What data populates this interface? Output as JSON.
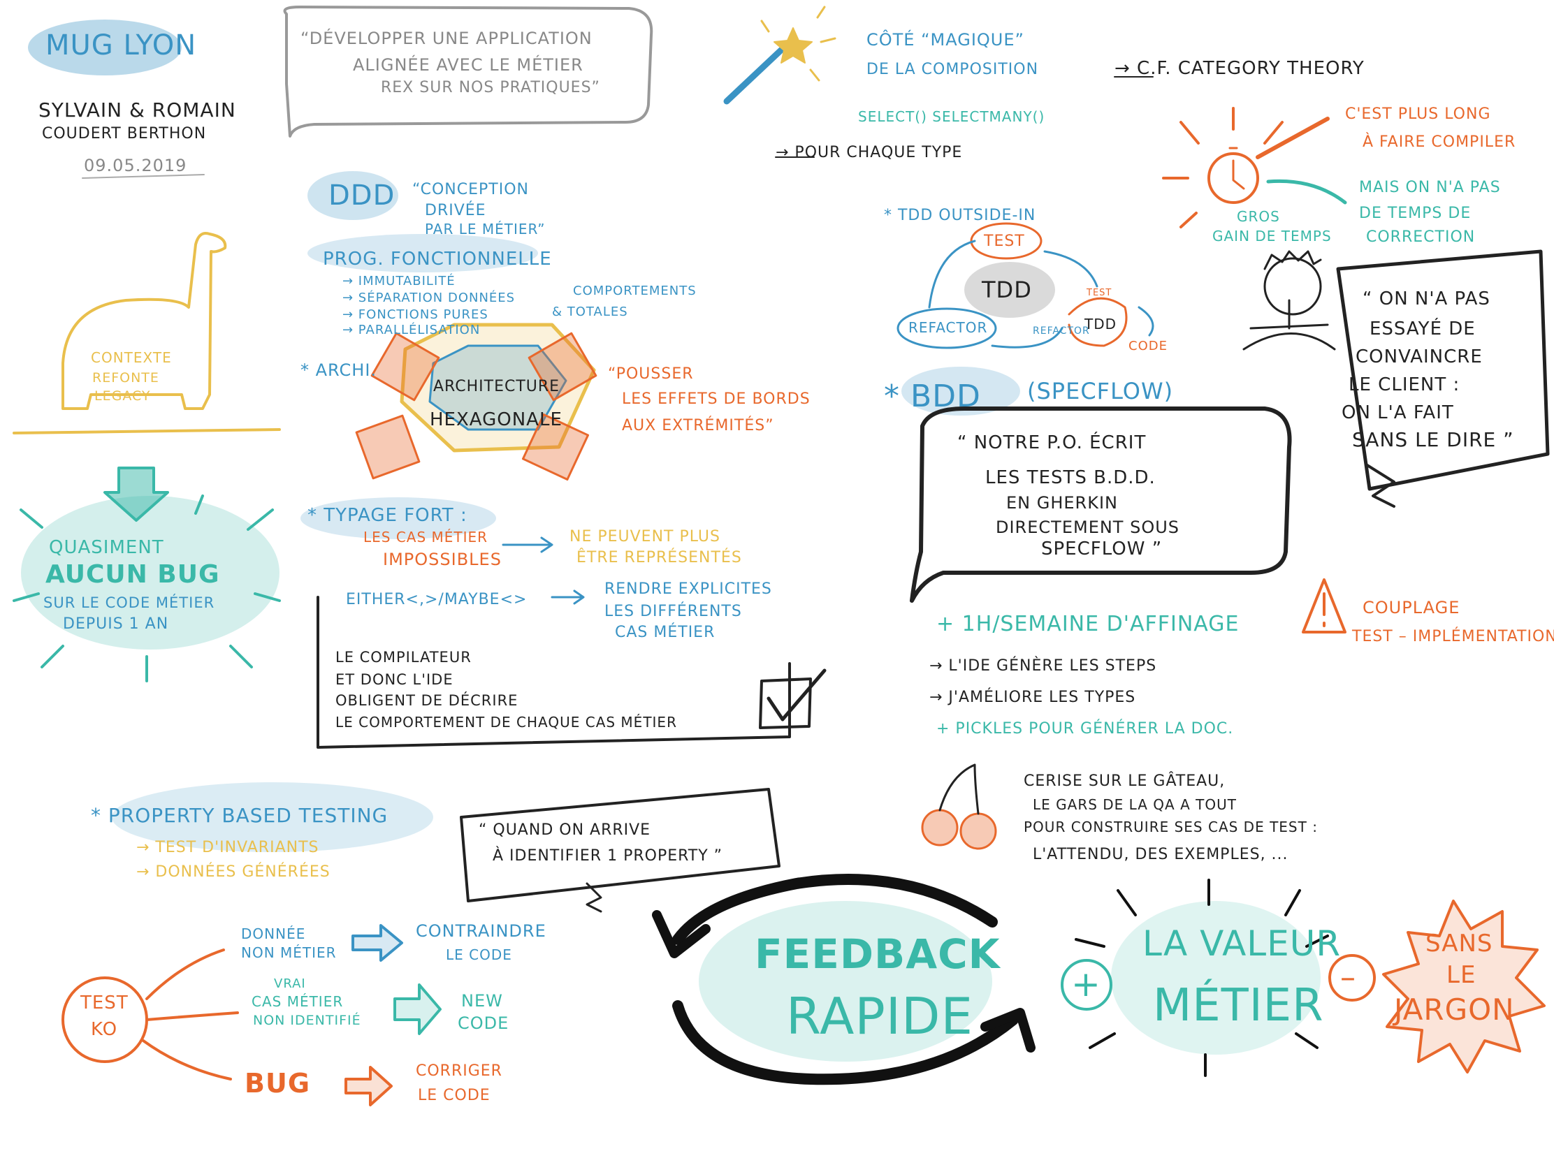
{
  "header": {
    "event": "MUG LYON",
    "speakers": "SYLVAIN & ROMAIN",
    "speakers_last": "COUDERT   BERTHON",
    "date": "09.05.2019",
    "quote_title": "“DÉVELOPPER UNE APPLICATION",
    "quote_title2": "ALIGNÉE AVEC LE MÉTIER",
    "quote_title3": "REX SUR NOS PRATIQUES”"
  },
  "dino": {
    "line1": "CONTEXTE",
    "line2": "REFONTE",
    "line3": "LEGACY"
  },
  "bug_burst": {
    "line1": "QUASIMENT",
    "line2": "AUCUN BUG",
    "line3": "SUR LE CODE MÉTIER",
    "line4": "DEPUIS 1 AN"
  },
  "ddd": {
    "title": "DDD",
    "desc1": "“CONCEPTION",
    "desc2": "DRIVÉE",
    "desc3": "PAR LE MÉTIER”"
  },
  "prog_fonc": {
    "title": "PROG. FONCTIONNELLE",
    "item1": "→ IMMUTABILITÉ",
    "item2": "→ SÉPARATION DONNÉES",
    "item2b": "COMPORTEMENTS",
    "item3": "→ FONCTIONS PURES",
    "item3b": "& TOTALES",
    "item4": "→ PARALLÉLISATION"
  },
  "archi": {
    "label": "* ARCHI.",
    "hex_line1": "ARCHITECTURE",
    "hex_line2": "HEXAGONALE",
    "note1": "“POUSSER",
    "note2": "LES EFFETS DE BORDS",
    "note3": "AUX EXTRÉMITÉS”"
  },
  "typage": {
    "title": "* TYPAGE FORT :",
    "line1": "LES CAS MÉTIER",
    "line2": "IMPOSSIBLES",
    "result1": "NE PEUVENT PLUS",
    "result2": "ÊTRE REPRÉSENTÉS",
    "either": "EITHER<,>/MAYBE<>",
    "explicit1": "RENDRE EXPLICITES",
    "explicit2": "LES DIFFÉRENTS",
    "explicit3": "CAS MÉTIER",
    "box1": "LE COMPILATEUR",
    "box2": "ET DONC L'IDE",
    "box3": "OBLIGENT DE DÉCRIRE",
    "box4": "LE COMPORTEMENT DE CHAQUE CAS MÉTIER"
  },
  "magic": {
    "line1": "CÔTÉ “MAGIQUE”",
    "line2": "DE LA COMPOSITION",
    "functions": "SELECT()   SELECTMANY()",
    "per_type": "→ POUR CHAQUE TYPE",
    "category": "→ C.F. CATEGORY THEORY"
  },
  "compile": {
    "longer1": "C'EST PLUS LONG",
    "longer2": "À FAIRE COMPILER",
    "gain1": "GROS",
    "gain2": "GAIN DE TEMPS",
    "noTime1": "MAIS ON N'A PAS",
    "noTime2": "DE TEMPS DE",
    "noTime3": "CORRECTION"
  },
  "tdd": {
    "title": "* TDD   OUTSIDE-IN",
    "test": "TEST",
    "center": "TDD",
    "refactor": "REFACTOR",
    "code": "CODE",
    "small_test": "TEST",
    "small_refactor": "REFACTOR",
    "small_tdd": "TDD"
  },
  "client_quote": {
    "line1": "“ ON N'A PAS",
    "line2": "ESSAYÉ DE",
    "line3": "CONVAINCRE",
    "line4": "LE CLIENT :",
    "line5": "ON L'A FAIT",
    "line6": "SANS LE DIRE ”"
  },
  "bdd": {
    "title": "* BDD",
    "tool": "(SPECFLOW)",
    "quote1": "“ NOTRE P.O. ÉCRIT",
    "quote2": "LES TESTS B.D.D.",
    "quote3": "EN GHERKIN",
    "quote4": "DIRECTEMENT SOUS",
    "quote5": "SPECFLOW ”",
    "affinage": "+ 1H/SEMAINE D'AFFINAGE",
    "ide": "→ L'IDE GÉNÈRE LES STEPS",
    "types": "→ J'AMÉLIORE LES TYPES",
    "pickles": "+ PICKLES POUR GÉNÉRER LA DOC."
  },
  "coupling": {
    "line1": "COUPLAGE",
    "line2": "TEST – IMPLÉMENTATION"
  },
  "cherry": {
    "line1": "CERISE SUR LE GÂTEAU,",
    "line2": "LE GARS DE LA QA A TOUT",
    "line3": "POUR CONSTRUIRE SES CAS DE TEST :",
    "line4": "L'ATTENDU, DES EXEMPLES, ..."
  },
  "pbt": {
    "title": "* PROPERTY BASED TESTING",
    "item1": "→ TEST D'INVARIANTS",
    "item2": "→ DONNÉES GÉNÉRÉES",
    "quote1": "“ QUAND ON ARRIVE",
    "quote2": "À IDENTIFIER 1 PROPERTY ”"
  },
  "test_ko": {
    "label1": "TEST",
    "label2": "KO",
    "b1a": "DONNÉE",
    "b1b": "NON MÉTIER",
    "r1a": "CONTRAINDRE",
    "r1b": "LE CODE",
    "b2a": "VRAI",
    "b2b": "CAS MÉTIER",
    "b2c": "NON IDENTIFIÉ",
    "r2a": "NEW",
    "r2b": "CODE",
    "b3": "BUG",
    "r3a": "CORRIGER",
    "r3b": "LE CODE"
  },
  "feedback": {
    "line1": "FEEDBACK",
    "line2": "RAPIDE",
    "plus": "+",
    "value1": "LA VALEUR",
    "value2": "MÉTIER",
    "minus": "–",
    "jargon1": "SANS",
    "jargon2": "LE",
    "jargon3": "JARGON"
  },
  "colors": {
    "teal": "#3ab8a8",
    "blue": "#3a93c4",
    "orange": "#e8682c",
    "yellow": "#e9bf4c"
  }
}
